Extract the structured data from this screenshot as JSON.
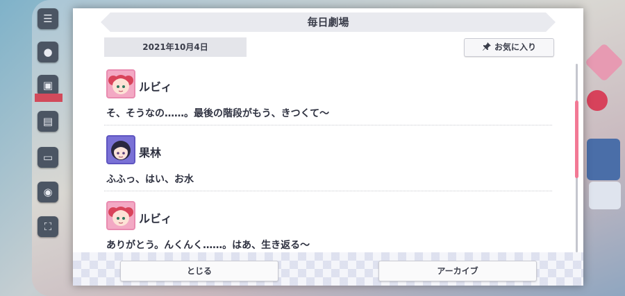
{
  "modal": {
    "title": "毎日劇場",
    "date": "2021年10月4日",
    "favorite_label": "お気に入り"
  },
  "dialogue": [
    {
      "speaker": "ルビィ",
      "line": "そ、そうなの……。最後の階段がもう、きつくて〜"
    },
    {
      "speaker": "果林",
      "line": "ふふっ、はい、お水"
    },
    {
      "speaker": "ルビィ",
      "line": "ありがとう。んくんく……。はあ、生き返る〜"
    }
  ],
  "buttons": {
    "close_label": "とじる",
    "archive_label": "アーカイブ"
  },
  "colors": {
    "accent_scroll": "#f27995",
    "ruby_frame": "#f3a9c4",
    "karin_frame": "#7a71d6"
  },
  "icons": [
    "menu-icon",
    "chat-icon",
    "gift-icon",
    "present-icon",
    "camera-icon",
    "expand-icon",
    "pin-icon"
  ]
}
